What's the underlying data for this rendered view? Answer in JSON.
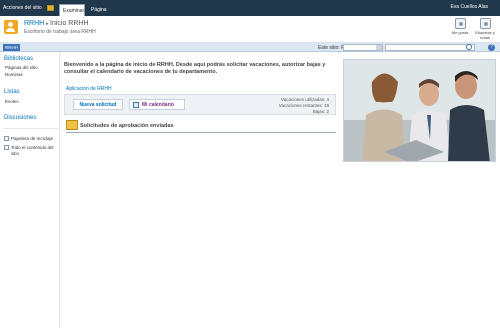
{
  "ribbon": {
    "site_actions": "Acciones del sitio",
    "tabs": [
      "Examinar",
      "Página"
    ],
    "user": "Eva Cuellos Alas"
  },
  "header": {
    "site_title": "RRHH",
    "separator": "▸",
    "page_title": "Inicio RRHH",
    "subtitle": "Escritorio de trabajo área RRHH",
    "social": [
      "Me gusta",
      "Etiquetas y notas"
    ]
  },
  "nav": {
    "home_tab": "RRHH",
    "scope_label": "Este sitio: RRHH",
    "scope_value": "",
    "help": "?"
  },
  "sidebar": {
    "sections": [
      {
        "heading": "Bibliotecas",
        "items": [
          "Páginas del sitio",
          "Nominas"
        ]
      },
      {
        "heading": "Listas",
        "items": [
          "Evotec"
        ]
      },
      {
        "heading": "Discusiones",
        "items": []
      }
    ],
    "recycle_bin": "Papelera de reciclaje",
    "all_content": "Todo el contenido del sitio"
  },
  "main": {
    "welcome": "Bienvenido a la página de inicio de RRHH. Desde aquí podrás solicitar vacaciones, autorizar bajas y consultar el calendario de vacaciones de tu departamento.",
    "app_link": "Aplicación de RRHH",
    "buttons": {
      "new_request": "Nueva solicitud",
      "calendar": "Mi calendario"
    },
    "stats": [
      "Vacaciones utilizadas: 4",
      "Vacaciones restantes: 19",
      "Bajas: 2"
    ],
    "approvals_title": "Solicitudes de aprobación enviadas"
  },
  "colors": {
    "ribbon": "#21374c",
    "accent": "#0072bc",
    "logo": "#f5a623"
  }
}
